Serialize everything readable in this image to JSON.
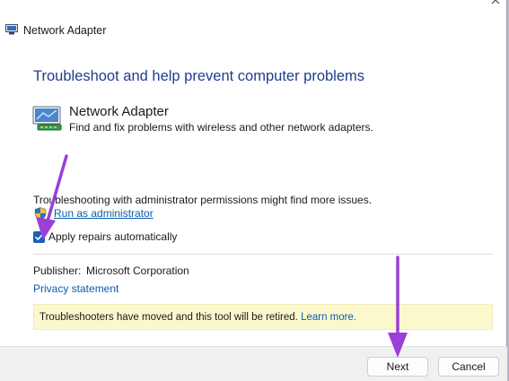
{
  "window": {
    "title": "Network Adapter"
  },
  "main": {
    "heading": "Troubleshoot and help prevent computer problems",
    "troubleshooter": {
      "name": "Network Adapter",
      "description": "Find and fix problems with wireless and other network adapters."
    },
    "permissions_text": "Troubleshooting with administrator permissions might find more issues.",
    "run_as_admin_label": "Run as administrator",
    "apply_repairs": {
      "label": "Apply repairs automatically",
      "checked": true
    },
    "publisher_label": "Publisher:",
    "publisher_value": "Microsoft Corporation",
    "privacy_label": "Privacy statement",
    "notice": {
      "text": "Troubleshooters have moved and this tool will be retired.",
      "link": "Learn more."
    }
  },
  "footer": {
    "next_label": "Next",
    "cancel_label": "Cancel"
  },
  "colors": {
    "heading": "#1e3d8f",
    "link": "#0b5cad",
    "checkbox": "#1862b6",
    "notice_bg": "#fcf8cd",
    "annotation_arrow": "#9b3fd9"
  }
}
